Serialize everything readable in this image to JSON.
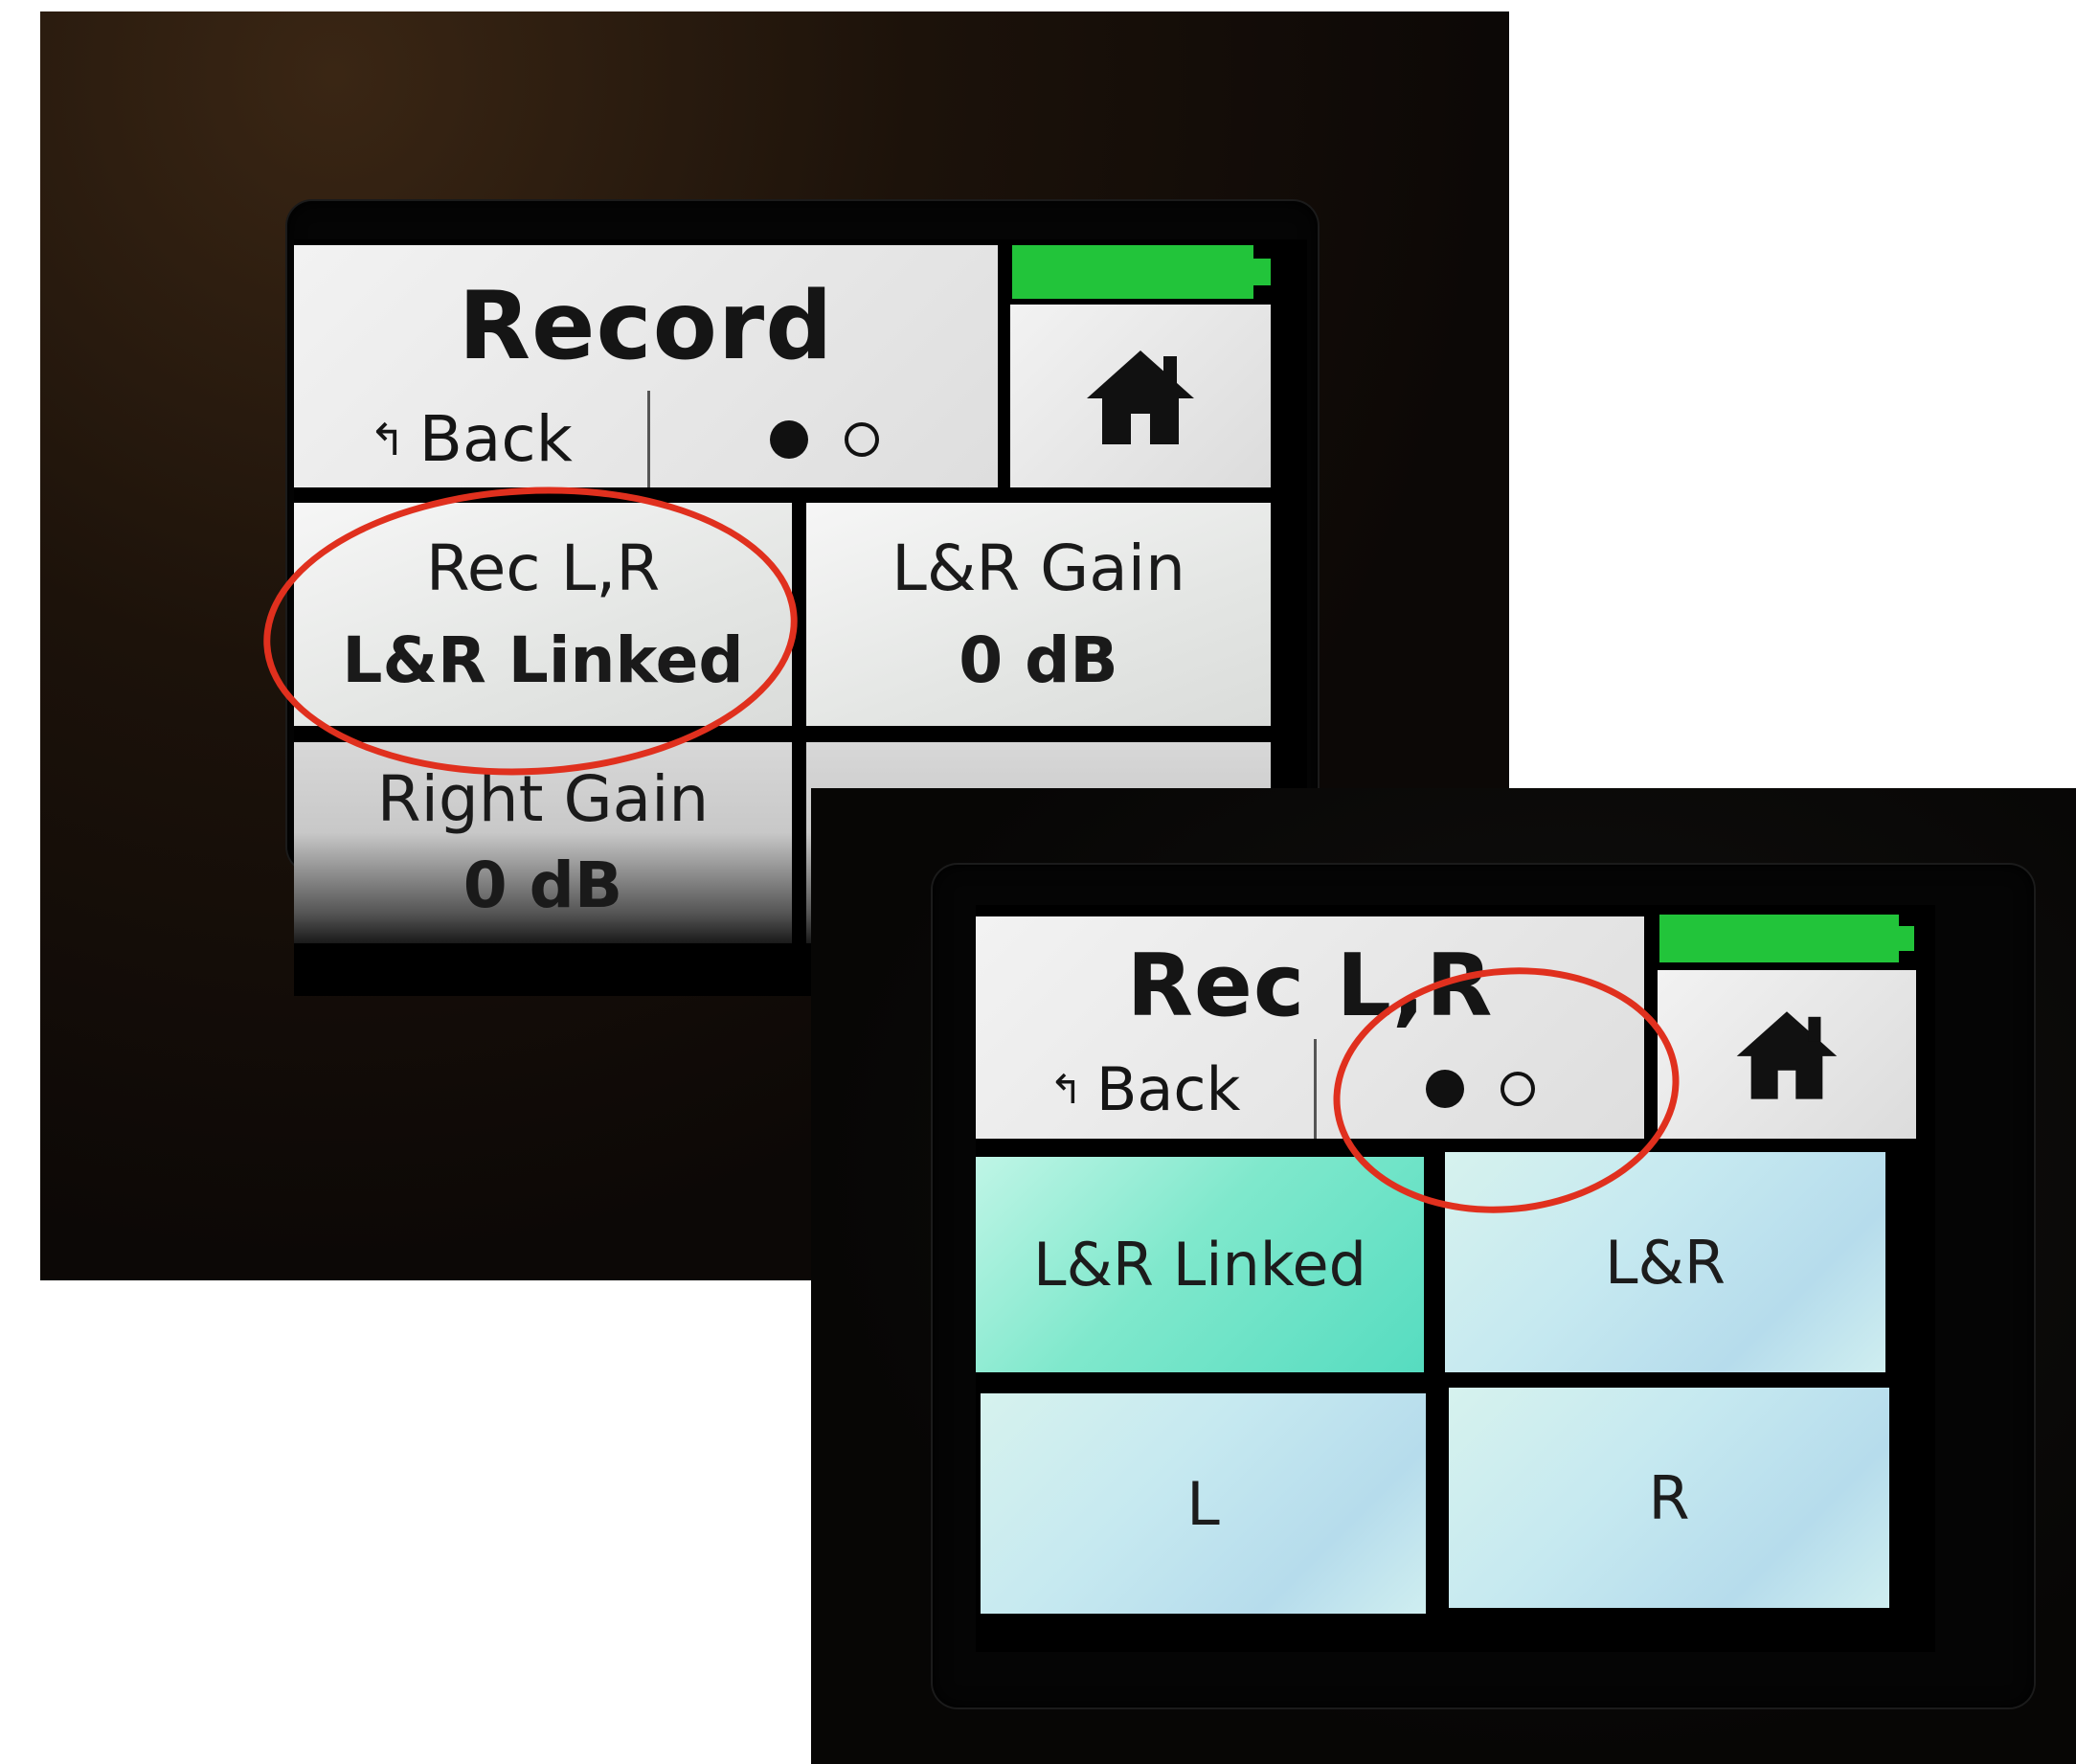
{
  "screen_record": {
    "title": "Record",
    "back_label": "Back",
    "back_arrow": "↰",
    "page_indicator": {
      "pages": 2,
      "current": 1
    },
    "battery_color": "#22c43a",
    "home_icon": "home-icon",
    "params": [
      {
        "label": "Rec L,R",
        "value": "L&R Linked"
      },
      {
        "label": "L&R Gain",
        "value": "0 dB"
      },
      {
        "label": "Right Gain",
        "value": "0 dB"
      }
    ]
  },
  "screen_rec_lr": {
    "title": "Rec L,R",
    "back_label": "Back",
    "back_arrow": "↰",
    "page_indicator": {
      "pages": 2,
      "current": 1
    },
    "battery_color": "#22c43a",
    "home_icon": "home-icon",
    "options": [
      {
        "label": "L&R Linked",
        "selected": true
      },
      {
        "label": "L&R",
        "selected": false
      },
      {
        "label": "L",
        "selected": false
      },
      {
        "label": "R",
        "selected": false
      }
    ]
  },
  "annotation_color": "#e0301e"
}
